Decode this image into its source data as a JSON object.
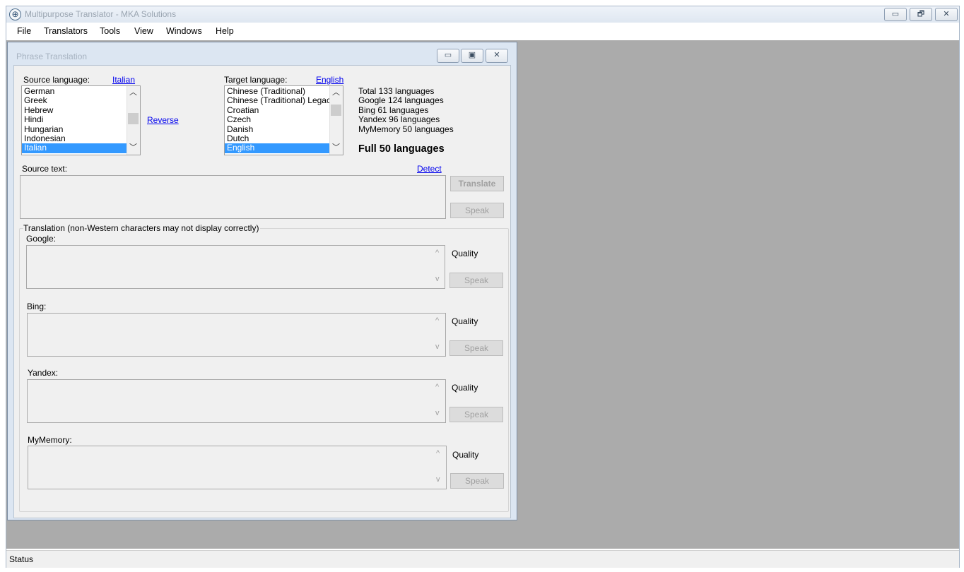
{
  "app": {
    "title": "Multipurpose Translator - MKA Solutions",
    "caption_icons": [
      "minimize-icon",
      "restore-icon",
      "close-icon"
    ],
    "caption_glyphs": {
      "minimize": "▭",
      "restore": "🗗",
      "close": "✕"
    }
  },
  "menu": [
    "File",
    "Translators",
    "Tools",
    "View",
    "Windows",
    "Help"
  ],
  "child": {
    "title": "Phrase Translation",
    "caption_glyphs": {
      "minimize": "▭",
      "maximize": "▣",
      "close": "✕"
    }
  },
  "source": {
    "label": "Source language:",
    "selected_link": "Italian",
    "languages": [
      "German",
      "Greek",
      "Hebrew",
      "Hindi",
      "Hungarian",
      "Indonesian",
      "Italian"
    ],
    "selected_index": 6,
    "reverse_link": "Reverse"
  },
  "target": {
    "label": "Target language:",
    "selected_link": "English",
    "languages": [
      "Chinese (Traditional)",
      "Chinese (Traditional) Legacy",
      "Croatian",
      "Czech",
      "Danish",
      "Dutch",
      "English"
    ],
    "selected_index": 6
  },
  "stats": {
    "lines": [
      "Total 133 languages",
      "Google 124 languages",
      "Bing 61 languages",
      "Yandex 96 languages",
      "MyMemory 50 languages"
    ],
    "full": "Full 50 languages"
  },
  "source_text": {
    "label": "Source text:",
    "detect_link": "Detect",
    "value": "",
    "translate_label": "Translate",
    "speak_label": "Speak"
  },
  "translation": {
    "group_label": "Translation (non-Western characters may not display correctly)",
    "providers": [
      {
        "name": "Google:",
        "quality_label": "Quality",
        "speak_label": "Speak",
        "value": ""
      },
      {
        "name": "Bing:",
        "quality_label": "Quality",
        "speak_label": "Speak",
        "value": ""
      },
      {
        "name": "Yandex:",
        "quality_label": "Quality",
        "speak_label": "Speak",
        "value": ""
      },
      {
        "name": "MyMemory:",
        "quality_label": "Quality",
        "speak_label": "Speak",
        "value": ""
      }
    ]
  },
  "status": {
    "text": "Status"
  },
  "scroll_glyphs": {
    "up": "^",
    "down": "v"
  }
}
